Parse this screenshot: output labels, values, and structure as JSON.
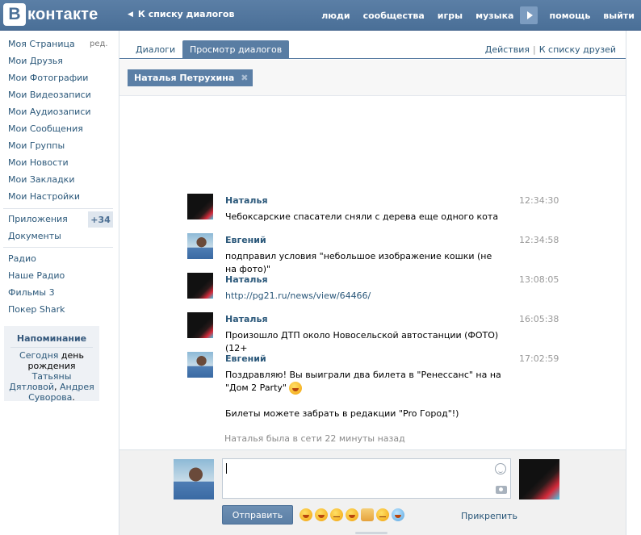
{
  "header": {
    "logo_letter": "B",
    "logo_text": "контакте",
    "back_label": "К списку диалогов",
    "nav": [
      "люди",
      "сообщества",
      "игры",
      "музыка",
      "помощь",
      "выйти"
    ]
  },
  "sidebar": {
    "items": [
      "Моя Страница",
      "Мои Друзья",
      "Мои Фотографии",
      "Мои Видеозаписи",
      "Мои Аудиозаписи",
      "Мои Сообщения",
      "Мои Группы",
      "Мои Новости",
      "Мои Закладки",
      "Мои Настройки"
    ],
    "edit_label": "ред.",
    "apps_label": "Приложения",
    "apps_badge": "+34",
    "docs_label": "Документы",
    "extra": [
      "Радио",
      "Наше Радио",
      "Фильмы 3",
      "Покер Shark"
    ]
  },
  "reminder": {
    "title": "Напоминание",
    "today": "Сегодня",
    "text1": "день",
    "text2": "рождения",
    "name1": "Татьяны Дятловой",
    "sep": ",",
    "name2": "Андрея Суворова",
    "end": "."
  },
  "tabs": {
    "dialogs": "Диалоги",
    "view": "Просмотр диалогов",
    "actions": "Действия",
    "separator": "|",
    "to_friends": "К списку друзей"
  },
  "recipient": {
    "name": "Наталья Петрухина",
    "remove": "✖"
  },
  "messages": [
    {
      "author": "Наталья",
      "time": "12:34:30",
      "text": "Чебоксарские спасатели сняли с дерева еще одного кота"
    },
    {
      "author": "Евгений",
      "time": "12:34:58",
      "text": "подправил условия \"небольшое изображение кошки (не на фото)\""
    },
    {
      "author": "Наталья",
      "time": "13:08:05",
      "text": "http://pg21.ru/news/view/64466/"
    },
    {
      "author": "Наталья",
      "time": "16:05:38",
      "text": "Произошло ДТП около Новосельской автостанции (ФОТО) (12+"
    },
    {
      "author": "Евгений",
      "time": "17:02:59",
      "text": "Поздравляю! Вы выиграли два билета в \"Ренессанс\" на на \"Дом 2 Party\"",
      "text2": "Билеты можете забрать в редакции \"Pro Город\"!)"
    }
  ],
  "status": "Наталья была в сети 22 минуты назад",
  "composer": {
    "send": "Отправить",
    "attach": "Прикрепить"
  }
}
